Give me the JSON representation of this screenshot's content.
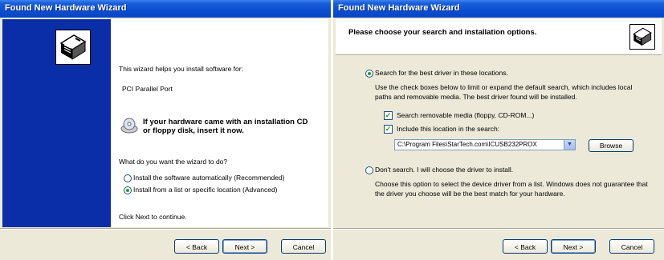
{
  "left_window": {
    "title": "Found New Hardware Wizard",
    "intro": "This wizard helps you install software for:",
    "device": "PCI Parallel Port",
    "cd_hint_line1": "If your hardware came with an installation CD",
    "cd_hint_line2": "or floppy disk, insert it now.",
    "question": "What do you want the wizard to do?",
    "options": [
      {
        "label": "Install the software automatically (Recommended)",
        "selected": false
      },
      {
        "label": "Install from a list or specific location (Advanced)",
        "selected": true
      }
    ],
    "footer": "Click Next to continue.",
    "buttons": {
      "back": "< Back",
      "next": "Next >",
      "cancel": "Cancel"
    }
  },
  "right_window": {
    "title": "Found New Hardware Wizard",
    "heading": "Please choose your search and installation options.",
    "search_option": {
      "label": "Search for the best driver in these locations.",
      "selected": true
    },
    "search_desc_line1": "Use the check boxes below to limit or expand the default search, which includes local",
    "search_desc_line2": "paths and removable media. The best driver found will be installed.",
    "checkboxes": [
      {
        "label": "Search removable media (floppy, CD-ROM...)",
        "checked": true
      },
      {
        "label": "Include this location in the search:",
        "checked": true
      }
    ],
    "location_path": "C:\\Program Files\\StarTech.com\\ICUSB232PROX",
    "browse_label": "Browse",
    "dont_search_option": {
      "label": "Don't search. I will choose the driver to install.",
      "selected": false
    },
    "dont_search_desc_line1": "Choose this option to select the device driver from a list.  Windows does not guarantee that",
    "dont_search_desc_line2": "the driver you choose will be the best match for your hardware.",
    "buttons": {
      "back": "< Back",
      "next": "Next >",
      "cancel": "Cancel"
    }
  },
  "colors": {
    "title_blue": "#0a4ed0",
    "banner_blue": "#0a2ea8",
    "dialog_bg": "#ece9d8"
  }
}
